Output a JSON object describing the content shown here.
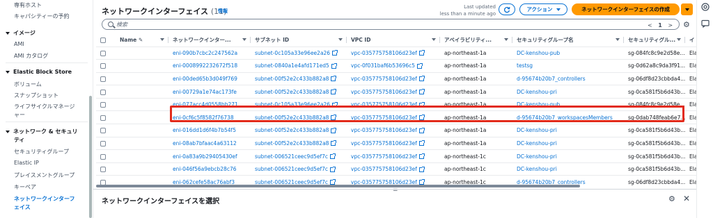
{
  "sidebar": {
    "items_top": [
      "専有ホスト",
      "キャパシティーの予約"
    ],
    "sections": [
      {
        "title": "イメージ",
        "items": [
          "AMI",
          "AMI カタログ"
        ]
      },
      {
        "title": "Elastic Block Store",
        "items": [
          "ボリューム",
          "スナップショット",
          "ライフサイクルマネージ",
          "ャー"
        ]
      },
      {
        "title": "ネットワーク & セキュリ",
        "title2": "ティ",
        "items": [
          "セキュリティグループ",
          "Elastic IP",
          "プレイスメントグループ",
          "キーペア"
        ]
      }
    ],
    "active_item_line1": "ネットワークインターフ",
    "active_item_line2": "ェイス"
  },
  "header": {
    "title": "ネットワークインターフェイス",
    "count": "(11)",
    "info": "情報",
    "last_updated_line1": "Last updated",
    "last_updated_line2": "less than a minute ago",
    "refresh_icon": "refresh-icon",
    "actions_label": "アクション",
    "create_label": "ネットワークインターフェイスの作成"
  },
  "search": {
    "placeholder": "検索",
    "page_prev": "<",
    "page_current": "1",
    "page_next": ">"
  },
  "table": {
    "headers": [
      "Name",
      "ネットワークインター...",
      "サブネット ID",
      "VPC ID",
      "アベイラビリティ...",
      "セキュリティグループ名",
      "セキュリティグル...",
      "イ"
    ],
    "rows": [
      [
        "",
        "eni-090b7cbc2c247562a",
        "subnet-0c105a33e96ee2a26",
        "vpc-035775758106d23ef",
        "ap-northeast-1a",
        "DC-kenshou-pub",
        "sg-084fc8c9e2d58e...",
        "Ela"
      ],
      [
        "",
        "eni-0008992232672f518",
        "subnet-0840a1e4afd171ed5",
        "vpc-0f031baf6b53696c5",
        "ap-northeast-1a",
        "testsg",
        "sg-0d62a8c9da3f91...",
        "Ela"
      ],
      [
        "",
        "eni-00ded65b3d049f769",
        "subnet-00f52e2c433b882a8",
        "vpc-035775758106d23ef",
        "ap-northeast-1a",
        "d-95674b20b7_controllers",
        "sg-06df8d23cbbda4...",
        "Ela"
      ],
      [
        "",
        "eni-00729a1e74ac173fe",
        "subnet-00f52e2c433b882a8",
        "vpc-035775758106d23ef",
        "ap-northeast-1a",
        "DC-kenshou-pri",
        "sg-0ca581f5b6d43b...",
        "Ela"
      ],
      [
        "",
        "eni-077acc4d0558bb271",
        "subnet-0c105a33e96ee2a26",
        "vpc-035775758106d23ef",
        "ap-northeast-1a",
        "DC-kenshou-pub",
        "sg-084fc8c9e2d58e...",
        "Ela"
      ],
      [
        "",
        "eni-0cf6c5f8582f76738",
        "subnet-00f52e2c433b882a8",
        "vpc-035775758106d23ef",
        "ap-northeast-1a",
        "d-95674b20b7_workspacesMembers",
        "sg-0dab748feab6e7...",
        "Ela"
      ],
      [
        "",
        "eni-016dd1d6f4b7b54f5",
        "subnet-00f52e2c433b882a8",
        "vpc-035775758106d23ef",
        "ap-northeast-1a",
        "DC-kenshou-pri",
        "sg-0ca581f5b6d43b...",
        "Ela"
      ],
      [
        "",
        "eni-08ab7bfaac4a63112",
        "subnet-00f52e2c433b882a8",
        "vpc-035775758106d23ef",
        "ap-northeast-1a",
        "DC-kenshou-pri",
        "sg-0ca581f5b6d43b...",
        "Ela"
      ],
      [
        "",
        "eni-0a83a9b29405430ef",
        "subnet-006521ceec9d5ef7c",
        "vpc-035775758106d23ef",
        "ap-northeast-1c",
        "DC-kenshou-pri",
        "sg-0ca581f5b6d43b...",
        "Ela"
      ],
      [
        "",
        "eni-046f56a9ebcb28c76",
        "subnet-006521ceec9d5ef7c",
        "vpc-035775758106d23ef",
        "ap-northeast-1c",
        "DC-kenshou-pri",
        "sg-0ca581f5b6d43b...",
        "Ela"
      ],
      [
        "",
        "eni-062cefe58ac76abf3",
        "subnet-006521ceec9d5ef7c",
        "vpc-035775758106d23ef",
        "ap-northeast-1c",
        "d-95674b20b7_controllers",
        "sg-06df8d23cbbda4...",
        "Ela"
      ]
    ]
  },
  "bottom_panel": {
    "title": "ネットワークインターフェイスを選択",
    "handle": "="
  },
  "colors": {
    "accent": "#0972d3",
    "primary_button": "#ff9900",
    "highlight": "#e22b1b"
  }
}
